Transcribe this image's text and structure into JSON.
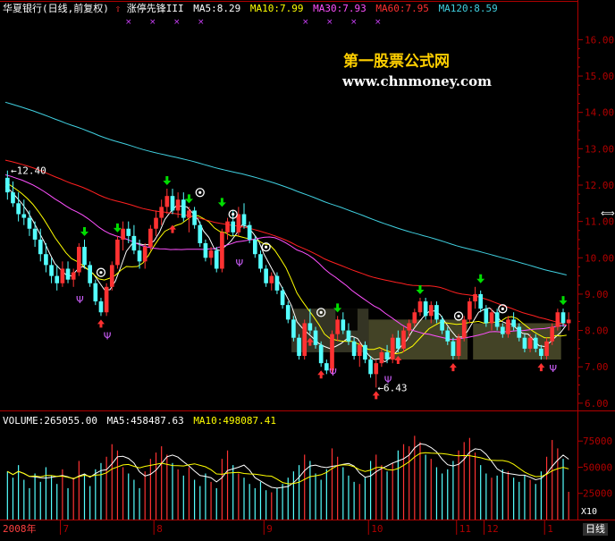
{
  "header": {
    "stock_title": "华夏银行(日线,前复权)",
    "indicator_name": "涨停先锋III",
    "ma5": "MA5:8.29",
    "ma10": "MA10:7.99",
    "ma30": "MA30:7.93",
    "ma60": "MA60:7.95",
    "ma120": "MA120:8.59"
  },
  "watermark": {
    "name": "第一股票公式网",
    "url": "www.chnmoney.com"
  },
  "volume_header": {
    "volume": "VOLUME:265055.00",
    "ma5": "MA5:458487.63",
    "ma10": "MA10:498087.41"
  },
  "bottom_bar": {
    "year_label": "2008年",
    "period_button": "日线",
    "volume_unit": "X10"
  },
  "colors": {
    "background": "#000000",
    "frame": "#b00000",
    "up": "#ff3232",
    "down": "#54ffff",
    "yellow": "#ffff00",
    "ma5": "#ffffff",
    "ma10": "#ffff00",
    "ma30": "#ff50ff",
    "ma60": "#ff2020",
    "ma120": "#40d0e0",
    "buy_arrow": "#ff3030",
    "sell_arrow": "#00ff00",
    "watermark_name": "#ffd000",
    "watermark_url": "#ffffff"
  },
  "chart_data": [
    {
      "type": "candlestick",
      "title": "华夏银行(日线,前复权)",
      "ylim": [
        5.8,
        16.6
      ],
      "y_ticks": [
        "16.00",
        "15.00",
        "14.00",
        "13.00",
        "12.00",
        "11.00",
        "10.00",
        "9.00",
        "8.00",
        "7.00",
        "6.00"
      ],
      "x_month_labels": [
        "7",
        "8",
        "9",
        "10",
        "11",
        "12",
        "1"
      ],
      "annotations": {
        "high": "←12.40",
        "low": "←6.43"
      },
      "ohlc": [
        [
          12.2,
          12.4,
          11.6,
          11.8
        ],
        [
          11.8,
          12.1,
          11.4,
          11.5
        ],
        [
          11.5,
          11.8,
          11.0,
          11.2
        ],
        [
          11.2,
          11.6,
          10.9,
          11.1
        ],
        [
          11.1,
          11.3,
          10.6,
          10.8
        ],
        [
          10.8,
          11.0,
          10.3,
          10.5
        ],
        [
          10.5,
          10.8,
          9.9,
          10.1
        ],
        [
          10.1,
          10.4,
          9.6,
          9.8
        ],
        [
          9.8,
          10.0,
          9.3,
          9.5
        ],
        [
          9.5,
          9.8,
          9.1,
          9.3
        ],
        [
          9.3,
          9.9,
          9.2,
          9.7
        ],
        [
          9.7,
          9.9,
          9.3,
          9.4
        ],
        [
          9.4,
          9.7,
          9.2,
          9.6
        ],
        [
          9.6,
          10.4,
          9.5,
          10.3
        ],
        [
          10.3,
          10.5,
          9.7,
          9.8
        ],
        [
          9.8,
          9.9,
          9.2,
          9.3
        ],
        [
          9.3,
          9.4,
          8.7,
          8.8
        ],
        [
          8.8,
          8.9,
          8.4,
          8.5
        ],
        [
          8.5,
          9.3,
          8.4,
          9.2
        ],
        [
          9.2,
          9.9,
          9.1,
          9.8
        ],
        [
          9.8,
          10.6,
          9.7,
          10.5
        ],
        [
          10.5,
          11.0,
          10.2,
          10.8
        ],
        [
          10.8,
          11.0,
          10.4,
          10.6
        ],
        [
          10.6,
          10.9,
          10.1,
          10.2
        ],
        [
          10.2,
          10.5,
          9.7,
          9.9
        ],
        [
          9.9,
          10.4,
          9.7,
          10.3
        ],
        [
          10.3,
          10.9,
          10.2,
          10.8
        ],
        [
          10.8,
          11.3,
          10.6,
          11.1
        ],
        [
          11.1,
          11.6,
          10.9,
          11.4
        ],
        [
          11.4,
          11.9,
          11.2,
          11.7
        ],
        [
          11.7,
          11.9,
          11.2,
          11.3
        ],
        [
          11.3,
          11.8,
          11.1,
          11.6
        ],
        [
          11.6,
          11.8,
          11.0,
          11.1
        ],
        [
          11.1,
          11.4,
          10.7,
          11.3
        ],
        [
          11.3,
          11.4,
          10.8,
          10.9
        ],
        [
          10.9,
          11.0,
          10.3,
          10.4
        ],
        [
          10.4,
          10.5,
          9.9,
          10.0
        ],
        [
          10.0,
          10.3,
          9.8,
          10.2
        ],
        [
          10.2,
          10.3,
          9.6,
          9.7
        ],
        [
          9.7,
          10.8,
          9.6,
          10.7
        ],
        [
          10.7,
          11.1,
          10.5,
          11.0
        ],
        [
          11.0,
          11.3,
          10.6,
          10.7
        ],
        [
          10.7,
          11.4,
          10.6,
          11.2
        ],
        [
          11.2,
          11.5,
          10.8,
          10.9
        ],
        [
          10.9,
          11.0,
          10.4,
          10.5
        ],
        [
          10.5,
          10.6,
          10.0,
          10.1
        ],
        [
          10.1,
          10.2,
          9.6,
          9.7
        ],
        [
          9.7,
          9.8,
          9.2,
          9.3
        ],
        [
          9.3,
          9.6,
          9.1,
          9.5
        ],
        [
          9.5,
          9.6,
          9.0,
          9.1
        ],
        [
          9.1,
          9.2,
          8.6,
          8.7
        ],
        [
          8.7,
          8.8,
          8.2,
          8.3
        ],
        [
          8.3,
          8.4,
          7.7,
          7.8
        ],
        [
          7.8,
          7.9,
          7.2,
          7.3
        ],
        [
          7.3,
          8.3,
          7.2,
          8.2
        ],
        [
          8.2,
          8.6,
          7.9,
          8.0
        ],
        [
          8.0,
          8.1,
          7.5,
          7.6
        ],
        [
          7.6,
          7.7,
          7.0,
          7.1
        ],
        [
          7.1,
          7.2,
          6.8,
          6.9
        ],
        [
          6.9,
          8.0,
          6.8,
          7.9
        ],
        [
          7.9,
          8.4,
          7.7,
          8.3
        ],
        [
          8.3,
          8.5,
          7.9,
          8.0
        ],
        [
          8.0,
          8.2,
          7.6,
          7.7
        ],
        [
          7.7,
          7.8,
          7.2,
          7.3
        ],
        [
          7.3,
          7.7,
          7.0,
          7.6
        ],
        [
          7.6,
          7.7,
          7.1,
          7.2
        ],
        [
          7.2,
          7.3,
          6.7,
          6.8
        ],
        [
          6.8,
          7.2,
          6.43,
          7.1
        ],
        [
          7.1,
          7.5,
          7.0,
          7.4
        ],
        [
          7.4,
          7.6,
          7.1,
          7.2
        ],
        [
          7.2,
          7.9,
          7.1,
          7.8
        ],
        [
          7.8,
          8.0,
          7.4,
          7.5
        ],
        [
          7.5,
          8.1,
          7.4,
          8.0
        ],
        [
          8.0,
          8.3,
          7.8,
          8.2
        ],
        [
          8.2,
          8.6,
          8.1,
          8.5
        ],
        [
          8.5,
          8.9,
          8.4,
          8.8
        ],
        [
          8.8,
          8.9,
          8.3,
          8.4
        ],
        [
          8.4,
          8.8,
          8.2,
          8.7
        ],
        [
          8.7,
          8.8,
          8.2,
          8.3
        ],
        [
          8.3,
          8.4,
          7.9,
          8.0
        ],
        [
          8.0,
          8.1,
          7.6,
          7.7
        ],
        [
          7.7,
          7.8,
          7.2,
          7.3
        ],
        [
          7.3,
          7.9,
          7.2,
          7.8
        ],
        [
          7.8,
          8.4,
          7.7,
          8.3
        ],
        [
          8.3,
          8.9,
          8.2,
          8.8
        ],
        [
          8.8,
          9.2,
          8.6,
          9.0
        ],
        [
          9.0,
          9.1,
          8.5,
          8.6
        ],
        [
          8.6,
          8.7,
          8.1,
          8.2
        ],
        [
          8.2,
          8.6,
          8.0,
          8.5
        ],
        [
          8.5,
          8.6,
          8.0,
          8.1
        ],
        [
          8.1,
          8.2,
          7.8,
          7.9
        ],
        [
          7.9,
          8.4,
          7.8,
          8.3
        ],
        [
          8.3,
          8.5,
          8.0,
          8.1
        ],
        [
          8.1,
          8.2,
          7.7,
          7.8
        ],
        [
          7.8,
          7.9,
          7.4,
          7.5
        ],
        [
          7.5,
          7.9,
          7.4,
          7.8
        ],
        [
          7.8,
          7.9,
          7.4,
          7.5
        ],
        [
          7.5,
          7.6,
          7.2,
          7.3
        ],
        [
          7.3,
          7.8,
          7.2,
          7.7
        ],
        [
          7.7,
          8.2,
          7.6,
          8.1
        ],
        [
          8.1,
          8.6,
          8.0,
          8.5
        ],
        [
          8.5,
          8.6,
          8.1,
          8.2
        ],
        [
          8.2,
          8.5,
          8.0,
          8.3
        ]
      ]
    },
    {
      "type": "bar",
      "title": "VOLUME",
      "y_ticks": [
        "75000",
        "50000",
        "25000"
      ],
      "y_range_x10": [
        0,
        88000
      ],
      "values_x10": [
        46000,
        40000,
        52000,
        38000,
        30000,
        44000,
        36000,
        50000,
        42000,
        34000,
        48000,
        30000,
        40000,
        56000,
        44000,
        32000,
        48000,
        54000,
        60000,
        72000,
        66000,
        50000,
        44000,
        38000,
        30000,
        46000,
        58000,
        64000,
        70000,
        62000,
        54000,
        48000,
        42000,
        50000,
        38000,
        32000,
        44000,
        36000,
        30000,
        58000,
        66000,
        52000,
        44000,
        40000,
        34000,
        30000,
        36000,
        28000,
        26000,
        30000,
        34000,
        40000,
        46000,
        52000,
        62000,
        56000,
        44000,
        38000,
        48000,
        68000,
        60000,
        50000,
        42000,
        36000,
        34000,
        40000,
        56000,
        62000,
        52000,
        46000,
        54000,
        66000,
        72000,
        70000,
        80000,
        74000,
        62000,
        58000,
        50000,
        44000,
        48000,
        56000,
        66000,
        74000,
        78000,
        64000,
        52000,
        44000,
        40000,
        42000,
        48000,
        46000,
        40000,
        36000,
        42000,
        38000,
        34000,
        46000,
        60000,
        76000,
        68000,
        58000,
        26506
      ]
    }
  ]
}
